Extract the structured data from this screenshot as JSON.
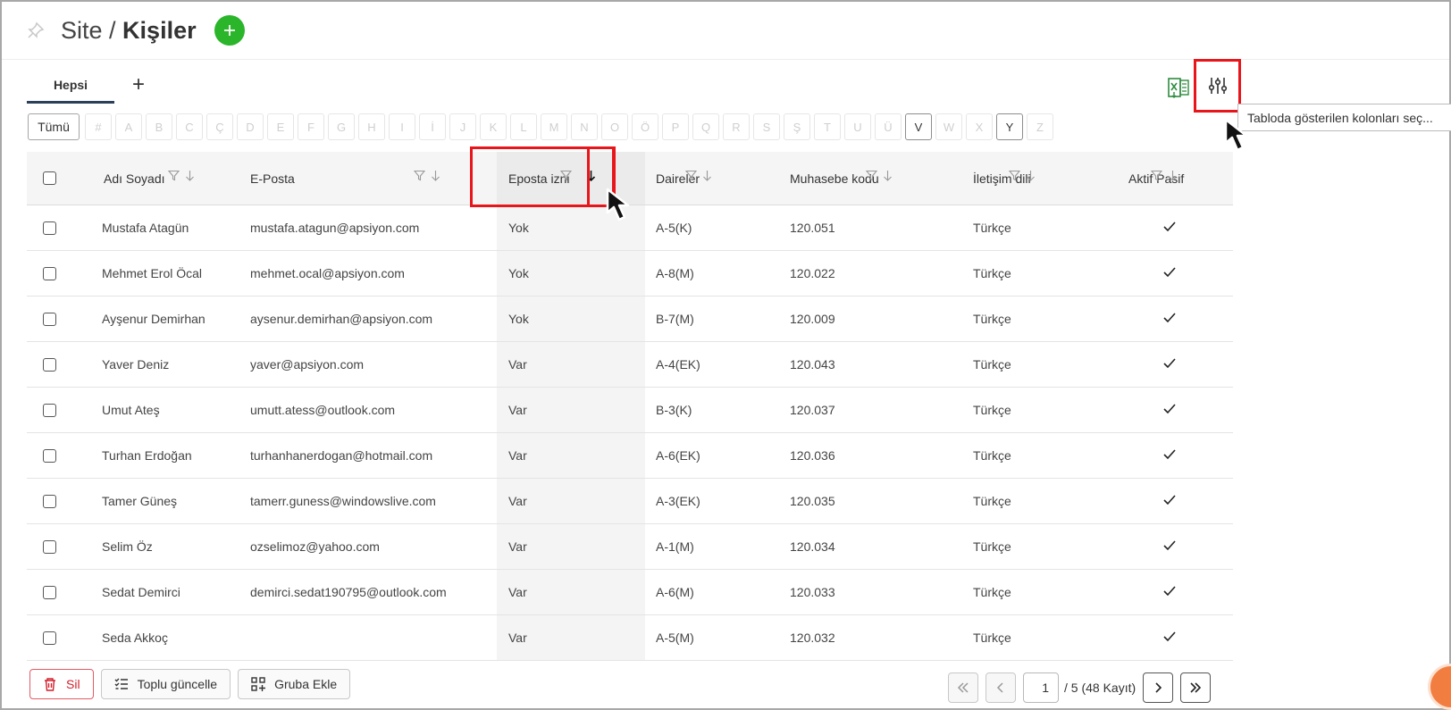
{
  "header": {
    "site": "Site",
    "separator": " / ",
    "page": "Kişiler"
  },
  "tabs": [
    {
      "label": "Hepsi"
    }
  ],
  "tab_add": "+",
  "tooltip": "Tabloda gösterilen kolonları seç...",
  "letters": [
    "Tümü",
    "#",
    "A",
    "B",
    "C",
    "Ç",
    "D",
    "E",
    "F",
    "G",
    "H",
    "I",
    "İ",
    "J",
    "K",
    "L",
    "M",
    "N",
    "O",
    "Ö",
    "P",
    "Q",
    "R",
    "S",
    "Ş",
    "T",
    "U",
    "Ü",
    "V",
    "W",
    "X",
    "Y",
    "Z"
  ],
  "active_letters": [
    "Tümü",
    "V",
    "Y"
  ],
  "columns": {
    "name": "Adı Soyadı",
    "email": "E-Posta",
    "perm": "Eposta izni",
    "apt": "Daireler",
    "acc": "Muhasebe kodu",
    "lang": "İletişim dili",
    "active": "Aktif Pasif"
  },
  "rows": [
    {
      "name": "Mustafa Atagün",
      "email": "mustafa.atagun@apsiyon.com",
      "perm": "Yok",
      "apt": "A-5(K)",
      "acc": "120.051",
      "lang": "Türkçe",
      "active": true
    },
    {
      "name": "Mehmet Erol Öcal",
      "email": "mehmet.ocal@apsiyon.com",
      "perm": "Yok",
      "apt": "A-8(M)",
      "acc": "120.022",
      "lang": "Türkçe",
      "active": true
    },
    {
      "name": "Ayşenur Demirhan",
      "email": "aysenur.demirhan@apsiyon.com",
      "perm": "Yok",
      "apt": "B-7(M)",
      "acc": "120.009",
      "lang": "Türkçe",
      "active": true
    },
    {
      "name": "Yaver Deniz",
      "email": "yaver@apsiyon.com",
      "perm": "Var",
      "apt": "A-4(EK)",
      "acc": "120.043",
      "lang": "Türkçe",
      "active": true
    },
    {
      "name": "Umut Ateş",
      "email": "umutt.atess@outlook.com",
      "perm": "Var",
      "apt": "B-3(K)",
      "acc": "120.037",
      "lang": "Türkçe",
      "active": true
    },
    {
      "name": "Turhan Erdoğan",
      "email": "turhanhanerdogan@hotmail.com",
      "perm": "Var",
      "apt": "A-6(EK)",
      "acc": "120.036",
      "lang": "Türkçe",
      "active": true
    },
    {
      "name": "Tamer Güneş",
      "email": "tamerr.guness@windowslive.com",
      "perm": "Var",
      "apt": "A-3(EK)",
      "acc": "120.035",
      "lang": "Türkçe",
      "active": true
    },
    {
      "name": "Selim Öz",
      "email": "ozselimoz@yahoo.com",
      "perm": "Var",
      "apt": "A-1(M)",
      "acc": "120.034",
      "lang": "Türkçe",
      "active": true
    },
    {
      "name": "Sedat Demirci",
      "email": "demirci.sedat190795@outlook.com",
      "perm": "Var",
      "apt": "A-6(M)",
      "acc": "120.033",
      "lang": "Türkçe",
      "active": true
    },
    {
      "name": "Seda Akkoç",
      "email": "",
      "perm": "Var",
      "apt": "A-5(M)",
      "acc": "120.032",
      "lang": "Türkçe",
      "active": true
    }
  ],
  "footer": {
    "delete": "Sil",
    "bulk_update": "Toplu güncelle",
    "add_group": "Gruba Ekle"
  },
  "pagination": {
    "current_page": "1",
    "info": "/ 5 (48 Kayıt)"
  },
  "colors": {
    "add_button": "#2ab52a",
    "highlight": "#e8151b",
    "tab_underline": "#2a3f59",
    "excel": "#2e8b3e",
    "help": "#f27d40"
  }
}
